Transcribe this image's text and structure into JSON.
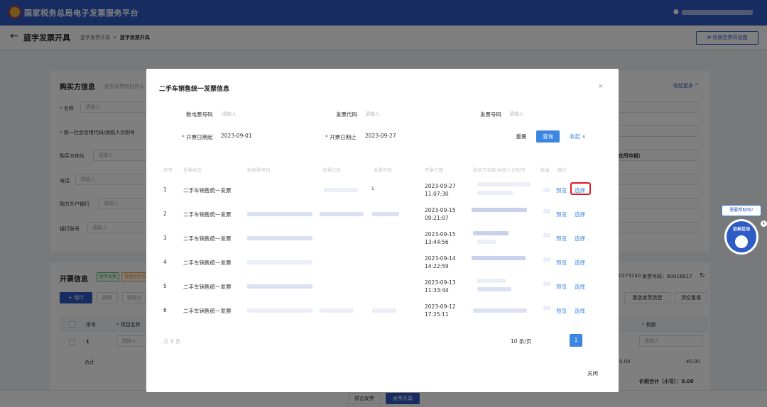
{
  "topbar": {
    "app_title": "国家税务总局电子发票服务平台",
    "user_icon": "user-icon"
  },
  "subhead": {
    "back_icon": "←",
    "title": "蓝字发票开具",
    "crumb_1": "蓝字发票开具",
    "crumb_sep": ">",
    "crumb_2": "蓝字发票开具",
    "switch_label": "⇄ 切换至票样视图"
  },
  "buyer": {
    "section_title": "购买方信息",
    "natural_person": "是否开票给自然人",
    "collapse_more": "收起更多 ^",
    "name_label": "名称",
    "name_placeholder": "请输入",
    "taxid_label": "统一社会信用代码/纳税人识别号",
    "address_label": "购买方地址",
    "address_placeholder": "请输入",
    "phone_label": "电话",
    "phone_placeholder": "请输入",
    "bank_label": "购方开户银行",
    "bank_placeholder": "请输入",
    "account_label": "银行账号",
    "account_placeholder": "请输入",
    "partial_text": "在所申报）"
  },
  "invoice": {
    "section_title": "开票信息",
    "tag_1": "税率发票",
    "tag_2": "增值税专用",
    "add_row": "+ 增行",
    "delete": "删除",
    "other": "税收分",
    "code_partial": "0173130",
    "number_label": "发票号码：60016017",
    "refresh_icon": "↻",
    "reselect_type": "重选发票类型",
    "clear_refill": "清空重填",
    "col_seq": "序号",
    "col_item": "项目名称",
    "col_tax": "税额",
    "row_1_seq": "1",
    "row_1_item": "请输入",
    "row_1_tax": "请输入",
    "total_label": "合计",
    "total_left": "0.00",
    "total_right": "¥0.00",
    "grand_total": "价税合计（小写）：0.00"
  },
  "bottom": {
    "preview": "预览发票",
    "issue": "发票开具"
  },
  "modal": {
    "title": "二手车销售统一发票信息",
    "close_icon": "×",
    "filter": {
      "einvoice_label": "数电票号码",
      "einvoice_placeholder": "请输入",
      "code_label": "发票代码",
      "code_placeholder": "请输入",
      "number_label": "发票号码",
      "number_placeholder": "请输入",
      "start_label": "开票日期起",
      "start_value": "2023-09-01",
      "end_label": "开票日期止",
      "end_value": "2023-09-27",
      "reset": "重置",
      "query": "查询",
      "collapse": "收起 ∧"
    },
    "columns": [
      "序号",
      "发票类型",
      "数电票号码",
      "发票代码",
      "发票号码",
      "开票日期",
      "购买方名称/纳税人识别号",
      "数量",
      "操作"
    ],
    "rows": [
      {
        "seq": "1",
        "type": "二手车销售统一发票",
        "date": "2023-09-27",
        "time": "11:07:30",
        "preview": "预览",
        "select": "选择",
        "num_mark": "1"
      },
      {
        "seq": "2",
        "type": "二手车销售统一发票",
        "date": "2023-09-15",
        "time": "09:21:07",
        "preview": "预览",
        "select": "选择"
      },
      {
        "seq": "3",
        "type": "二手车销售统一发票",
        "date": "2023-09-15",
        "time": "13:44:56",
        "preview": "预览",
        "select": "选择"
      },
      {
        "seq": "4",
        "type": "二手车销售统一发票",
        "date": "2023-09-14",
        "time": "14:22:59",
        "preview": "预览",
        "select": "选择"
      },
      {
        "seq": "5",
        "type": "二手车销售统一发票",
        "date": "2023-09-13",
        "time": "11:33:44",
        "preview": "预览",
        "select": "选择"
      },
      {
        "seq": "6",
        "type": "二手车销售统一发票",
        "date": "2023-09-12",
        "time": "17:25:11",
        "preview": "预览",
        "select": "选择"
      }
    ],
    "total": "共 6 条",
    "page_size": "10 条/页",
    "page": "1",
    "close_btn": "关闭"
  },
  "help": {
    "bubble": "需要帮助吗?",
    "widget_label": "征纳互动",
    "plus": "+"
  }
}
